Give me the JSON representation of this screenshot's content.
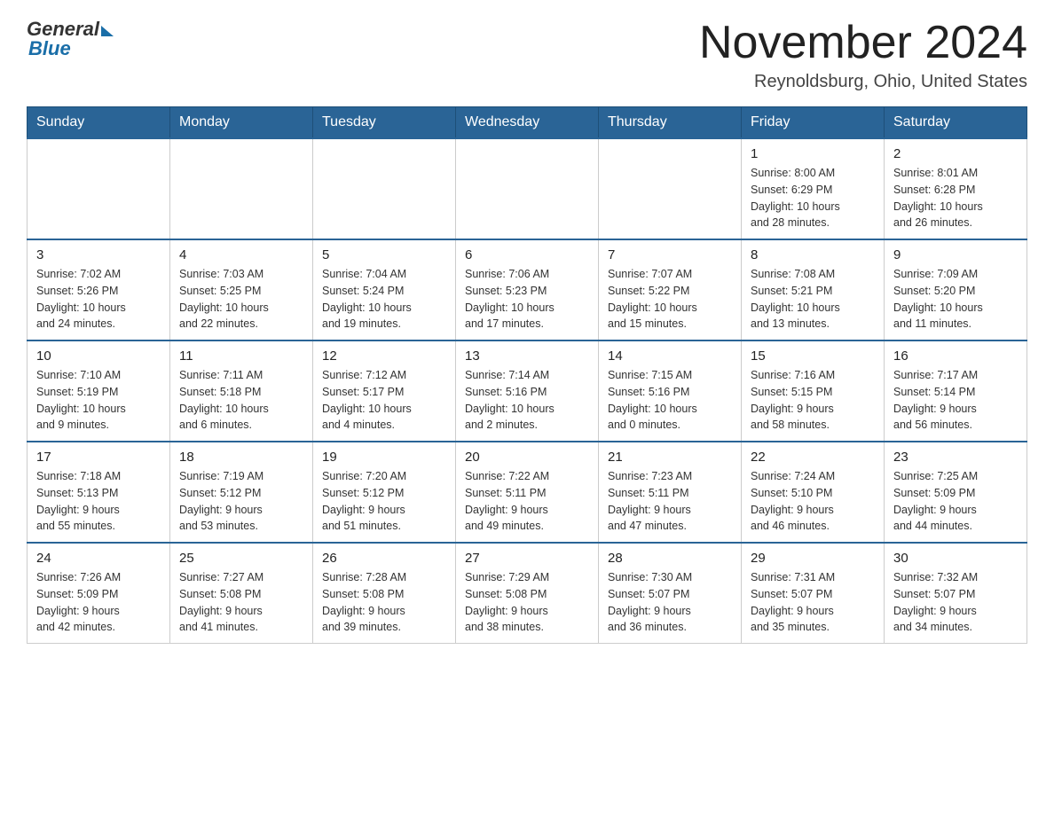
{
  "header": {
    "logo_general": "General",
    "logo_blue": "Blue",
    "month_title": "November 2024",
    "location": "Reynoldsburg, Ohio, United States"
  },
  "days_of_week": [
    "Sunday",
    "Monday",
    "Tuesday",
    "Wednesday",
    "Thursday",
    "Friday",
    "Saturday"
  ],
  "weeks": [
    [
      {
        "day": "",
        "info": "",
        "empty": true
      },
      {
        "day": "",
        "info": "",
        "empty": true
      },
      {
        "day": "",
        "info": "",
        "empty": true
      },
      {
        "day": "",
        "info": "",
        "empty": true
      },
      {
        "day": "",
        "info": "",
        "empty": true
      },
      {
        "day": "1",
        "info": "Sunrise: 8:00 AM\nSunset: 6:29 PM\nDaylight: 10 hours\nand 28 minutes.",
        "empty": false
      },
      {
        "day": "2",
        "info": "Sunrise: 8:01 AM\nSunset: 6:28 PM\nDaylight: 10 hours\nand 26 minutes.",
        "empty": false
      }
    ],
    [
      {
        "day": "3",
        "info": "Sunrise: 7:02 AM\nSunset: 5:26 PM\nDaylight: 10 hours\nand 24 minutes.",
        "empty": false
      },
      {
        "day": "4",
        "info": "Sunrise: 7:03 AM\nSunset: 5:25 PM\nDaylight: 10 hours\nand 22 minutes.",
        "empty": false
      },
      {
        "day": "5",
        "info": "Sunrise: 7:04 AM\nSunset: 5:24 PM\nDaylight: 10 hours\nand 19 minutes.",
        "empty": false
      },
      {
        "day": "6",
        "info": "Sunrise: 7:06 AM\nSunset: 5:23 PM\nDaylight: 10 hours\nand 17 minutes.",
        "empty": false
      },
      {
        "day": "7",
        "info": "Sunrise: 7:07 AM\nSunset: 5:22 PM\nDaylight: 10 hours\nand 15 minutes.",
        "empty": false
      },
      {
        "day": "8",
        "info": "Sunrise: 7:08 AM\nSunset: 5:21 PM\nDaylight: 10 hours\nand 13 minutes.",
        "empty": false
      },
      {
        "day": "9",
        "info": "Sunrise: 7:09 AM\nSunset: 5:20 PM\nDaylight: 10 hours\nand 11 minutes.",
        "empty": false
      }
    ],
    [
      {
        "day": "10",
        "info": "Sunrise: 7:10 AM\nSunset: 5:19 PM\nDaylight: 10 hours\nand 9 minutes.",
        "empty": false
      },
      {
        "day": "11",
        "info": "Sunrise: 7:11 AM\nSunset: 5:18 PM\nDaylight: 10 hours\nand 6 minutes.",
        "empty": false
      },
      {
        "day": "12",
        "info": "Sunrise: 7:12 AM\nSunset: 5:17 PM\nDaylight: 10 hours\nand 4 minutes.",
        "empty": false
      },
      {
        "day": "13",
        "info": "Sunrise: 7:14 AM\nSunset: 5:16 PM\nDaylight: 10 hours\nand 2 minutes.",
        "empty": false
      },
      {
        "day": "14",
        "info": "Sunrise: 7:15 AM\nSunset: 5:16 PM\nDaylight: 10 hours\nand 0 minutes.",
        "empty": false
      },
      {
        "day": "15",
        "info": "Sunrise: 7:16 AM\nSunset: 5:15 PM\nDaylight: 9 hours\nand 58 minutes.",
        "empty": false
      },
      {
        "day": "16",
        "info": "Sunrise: 7:17 AM\nSunset: 5:14 PM\nDaylight: 9 hours\nand 56 minutes.",
        "empty": false
      }
    ],
    [
      {
        "day": "17",
        "info": "Sunrise: 7:18 AM\nSunset: 5:13 PM\nDaylight: 9 hours\nand 55 minutes.",
        "empty": false
      },
      {
        "day": "18",
        "info": "Sunrise: 7:19 AM\nSunset: 5:12 PM\nDaylight: 9 hours\nand 53 minutes.",
        "empty": false
      },
      {
        "day": "19",
        "info": "Sunrise: 7:20 AM\nSunset: 5:12 PM\nDaylight: 9 hours\nand 51 minutes.",
        "empty": false
      },
      {
        "day": "20",
        "info": "Sunrise: 7:22 AM\nSunset: 5:11 PM\nDaylight: 9 hours\nand 49 minutes.",
        "empty": false
      },
      {
        "day": "21",
        "info": "Sunrise: 7:23 AM\nSunset: 5:11 PM\nDaylight: 9 hours\nand 47 minutes.",
        "empty": false
      },
      {
        "day": "22",
        "info": "Sunrise: 7:24 AM\nSunset: 5:10 PM\nDaylight: 9 hours\nand 46 minutes.",
        "empty": false
      },
      {
        "day": "23",
        "info": "Sunrise: 7:25 AM\nSunset: 5:09 PM\nDaylight: 9 hours\nand 44 minutes.",
        "empty": false
      }
    ],
    [
      {
        "day": "24",
        "info": "Sunrise: 7:26 AM\nSunset: 5:09 PM\nDaylight: 9 hours\nand 42 minutes.",
        "empty": false
      },
      {
        "day": "25",
        "info": "Sunrise: 7:27 AM\nSunset: 5:08 PM\nDaylight: 9 hours\nand 41 minutes.",
        "empty": false
      },
      {
        "day": "26",
        "info": "Sunrise: 7:28 AM\nSunset: 5:08 PM\nDaylight: 9 hours\nand 39 minutes.",
        "empty": false
      },
      {
        "day": "27",
        "info": "Sunrise: 7:29 AM\nSunset: 5:08 PM\nDaylight: 9 hours\nand 38 minutes.",
        "empty": false
      },
      {
        "day": "28",
        "info": "Sunrise: 7:30 AM\nSunset: 5:07 PM\nDaylight: 9 hours\nand 36 minutes.",
        "empty": false
      },
      {
        "day": "29",
        "info": "Sunrise: 7:31 AM\nSunset: 5:07 PM\nDaylight: 9 hours\nand 35 minutes.",
        "empty": false
      },
      {
        "day": "30",
        "info": "Sunrise: 7:32 AM\nSunset: 5:07 PM\nDaylight: 9 hours\nand 34 minutes.",
        "empty": false
      }
    ]
  ]
}
